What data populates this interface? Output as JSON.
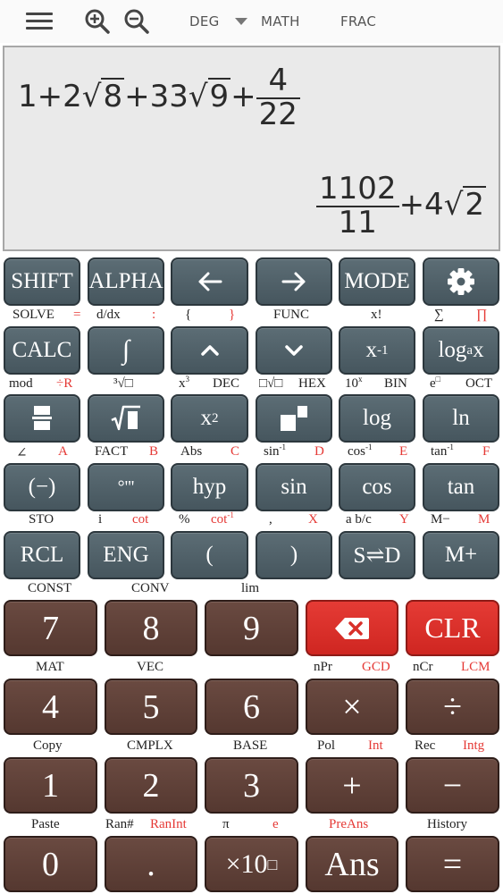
{
  "topbar": {
    "angle_mode": "DEG",
    "input_mode": "MATH",
    "result_mode": "FRAC",
    "icons": [
      "menu-icon",
      "zoom-in-icon",
      "zoom-out-icon",
      "caret-down-icon"
    ]
  },
  "display": {
    "expression": {
      "a": "1+2",
      "b": "8",
      "c": "+33",
      "d": "9",
      "e": "+",
      "frac_num": "4",
      "frac_den": "22"
    },
    "result": {
      "frac_num": "1102",
      "frac_den": "11",
      "plus": "+4",
      "rad": "2"
    }
  },
  "colors": {
    "gray_key": "#4f5f67",
    "brown_key": "#5f4037",
    "red_key": "#d8302a",
    "secondary_red": "#e53935"
  },
  "row1": {
    "shift": "SHIFT",
    "alpha": "ALPHA",
    "left": "←",
    "right": "→",
    "mode": "MODE",
    "settings_icon": "gear-icon"
  },
  "row1_labels": {
    "solve": "SOLVE",
    "eq": "=",
    "ddx": "d/dx",
    "colon": ":",
    "lbrace": "{",
    "rbrace": "}",
    "func": "FUNC",
    "fact": "x!",
    "sum": "∑",
    "prod": "∏"
  },
  "row2": {
    "calc": "CALC",
    "integral": "∫",
    "up": "⌃",
    "down": "⌄",
    "inv_base": "x",
    "inv_exp": "-1",
    "log_a": "log",
    "log_sub": "a",
    "log_x": "x"
  },
  "row2_labels": {
    "mod": "mod",
    "divr": "÷R",
    "cbrt": "³√□",
    "cube_base": "x",
    "cube_exp": "3",
    "dec": "DEC",
    "nthroot": "□√□",
    "hex": "HEX",
    "ten_base": "10",
    "ten_exp": "x",
    "bin": "BIN",
    "e_base": "e",
    "e_exp": "□",
    "oct": "OCT"
  },
  "row3": {
    "fraction_icon": "fraction-icon",
    "sqrt_icon": "sqrt-icon",
    "sq_base": "x",
    "sq_exp": "2",
    "power_icon": "power-icon",
    "log": "log",
    "ln": "ln"
  },
  "row3_labels": {
    "angle": "∠",
    "A": "A",
    "fact": "FACT",
    "B": "B",
    "abs": "Abs",
    "C": "C",
    "asin": "sin",
    "asin_exp": "-1",
    "D": "D",
    "acos": "cos",
    "acos_exp": "-1",
    "E": "E",
    "atan": "tan",
    "atan_exp": "-1",
    "F": "F"
  },
  "row4": {
    "neg": "(−)",
    "dms": "°'''",
    "hyp": "hyp",
    "sin": "sin",
    "cos": "cos",
    "tan": "tan"
  },
  "row4_labels": {
    "sto": "STO",
    "i": "i",
    "cot": "cot",
    "pct": "%",
    "acot": "cot",
    "acot_exp": "-1",
    "comma": ",",
    "X": "X",
    "abc": "a b/c",
    "Y": "Y",
    "mminus": "M−",
    "M": "M"
  },
  "row5": {
    "rcl": "RCL",
    "eng": "ENG",
    "lparen": "(",
    "rparen": ")",
    "sd": "S⇌D",
    "mplus": "M+"
  },
  "row5_labels": {
    "const": "CONST",
    "conv": "CONV",
    "lim": "lim"
  },
  "row6": {
    "seven": "7",
    "eight": "8",
    "nine": "9",
    "backspace_icon": "backspace-icon",
    "clr": "CLR"
  },
  "row6_labels": {
    "mat": "MAT",
    "vec": "VEC",
    "npr": "nPr",
    "gcd": "GCD",
    "ncr": "nCr",
    "lcm": "LCM"
  },
  "row7": {
    "four": "4",
    "five": "5",
    "six": "6",
    "mul": "×",
    "div": "÷"
  },
  "row7_labels": {
    "copy": "Copy",
    "cmplx": "CMPLX",
    "base": "BASE",
    "pol": "Pol",
    "int": "Int",
    "rec": "Rec",
    "intg": "Intg"
  },
  "row8": {
    "one": "1",
    "two": "2",
    "three": "3",
    "plus": "+",
    "minus": "−"
  },
  "row8_labels": {
    "paste": "Paste",
    "ran": "Ran#",
    "ranint": "RanInt",
    "pi": "π",
    "e": "e",
    "preans": "PreAns",
    "history": "History"
  },
  "row9": {
    "zero": "0",
    "dot": ".",
    "x10": "×10",
    "x10_box": "□",
    "ans": "Ans",
    "eq": "="
  }
}
